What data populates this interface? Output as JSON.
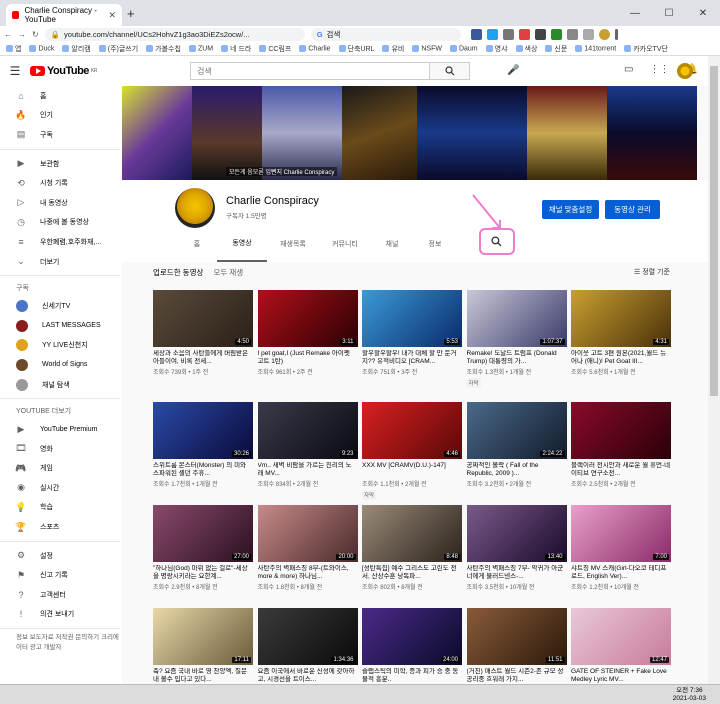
{
  "browser": {
    "tab_title": "Charlie Conspiracy - YouTube",
    "new_tab": "+",
    "url": "youtube.com/channel/UCs2HohvZ1g3ao3DiEZs2ocw/...",
    "google_search": "검색",
    "bookmarks": [
      "앱",
      "Duck",
      "알리캠",
      "(주)글쓰기",
      "가볼수칩",
      "ZUM",
      "네 드라",
      "CC림프",
      "Charlie",
      "단축URL",
      "유비",
      "NSFW",
      "Daum",
      "영샤",
      "색상",
      "신문",
      "141torrent",
      "카카오TV단"
    ]
  },
  "yt": {
    "logo_text": "YouTube",
    "logo_region": "KR",
    "search_placeholder": "검색"
  },
  "sidebar": {
    "main": [
      {
        "label": "홈",
        "icon": "home-icon"
      },
      {
        "label": "인기",
        "icon": "fire-icon"
      },
      {
        "label": "구독",
        "icon": "subscriptions-icon"
      }
    ],
    "library": [
      {
        "label": "보관함",
        "icon": "library-icon"
      },
      {
        "label": "시청 기록",
        "icon": "history-icon"
      },
      {
        "label": "내 동영상",
        "icon": "my-videos-icon"
      },
      {
        "label": "나중에 볼 동영상",
        "icon": "clock-icon"
      },
      {
        "label": "우한폐렴,호주화재,...",
        "icon": "playlist-icon"
      },
      {
        "label": "더보기",
        "icon": "chevron-down-icon"
      }
    ],
    "subs_head": "구독",
    "subs": [
      {
        "label": "신세기TV",
        "color": "#4a76c9"
      },
      {
        "label": "LAST MESSAGES",
        "color": "#8a1c1c"
      },
      {
        "label": "YY LIVE신천지",
        "color": "#e0a020"
      },
      {
        "label": "World of Signs",
        "color": "#6a4a2a"
      },
      {
        "label": "채널 탐색",
        "color": "#999999"
      }
    ],
    "more_head": "YOUTUBE 더보기",
    "more": [
      {
        "label": "YouTube Premium",
        "icon": "youtube-icon"
      },
      {
        "label": "영화",
        "icon": "film-icon"
      },
      {
        "label": "게임",
        "icon": "gamepad-icon"
      },
      {
        "label": "실시간",
        "icon": "live-icon"
      },
      {
        "label": "학습",
        "icon": "bulb-icon"
      },
      {
        "label": "스포츠",
        "icon": "trophy-icon"
      }
    ],
    "settings": [
      {
        "label": "설정",
        "icon": "gear-icon"
      },
      {
        "label": "신고 기록",
        "icon": "flag-icon"
      },
      {
        "label": "고객센터",
        "icon": "help-icon"
      },
      {
        "label": "의견 보내기",
        "icon": "feedback-icon"
      }
    ],
    "footer": "정보 보도자료 저작권 문의하기 크리에이터 광고 개발자"
  },
  "banner": {
    "caption": "모든게 음모론 입뻔지 Charlie Conspiracy"
  },
  "channel": {
    "name": "Charlie Conspiracy",
    "subscribers": "구독자 1.5만명",
    "customize_label": "채널 맞춤설정",
    "manage_label": "동영상 관리",
    "tabs": [
      "홈",
      "동영상",
      "재생목록",
      "커뮤니티",
      "채널",
      "정보"
    ],
    "active_tab": "동영상"
  },
  "videos_section": {
    "title": "업로드한 동영상",
    "play_all": "모두 재생",
    "sort_label": "정렬 기준"
  },
  "videos": [
    {
      "title": "세상과 소음의 사탄들에게 버림받은 아들이여, 비록 전세...",
      "meta": "조회수 739회 • 1주 전",
      "duration": "4:50",
      "c1": "#5a4a3a",
      "c2": "#2a2018"
    },
    {
      "title": "I pet goat,I (Just Remake 아이펫 고트 1탄)",
      "meta": "조회수 961회 • 2주 전",
      "duration": "3:11",
      "c1": "#b0101a",
      "c2": "#2a0004"
    },
    {
      "title": "할우할우할우! 내가 대체 할 만 둔거지?? 유적비디오 [CRAM...",
      "meta": "조회수 751회 • 3주 전",
      "duration": "5:53",
      "c1": "#3a9ad8",
      "c2": "#0a2a6a"
    },
    {
      "title": "Remake! 도날드 트럼프 (Donald Trump) 대통령의 가...",
      "meta": "조회수 1.3천회 • 1개월 전",
      "duration": "1:07:37",
      "c1": "#c8c8d8",
      "c2": "#3a3a6a",
      "badge": "자막"
    },
    {
      "title": "아이웃 고트 3편 원본(2021,월드 뉴어나 (애니)! Pet Goat III...",
      "meta": "조회수 5.6천회 • 1개월 전",
      "duration": "4:31",
      "c1": "#c8a030",
      "c2": "#4a3008"
    },
    {
      "title": "스위트룸 몬스터(Monster) 의 미와 스파워된 셸던 주휴...",
      "meta": "조회수 1.7천회 • 1개월 전",
      "duration": "30:26",
      "c1": "#2a4aa8",
      "c2": "#0a0a3a"
    },
    {
      "title": "Vm.. 새벽 비람을 가르는 진리의 노래 MV...",
      "meta": "조회수 834회 • 2개월 전",
      "duration": "9:23",
      "c1": "#3a3a4a",
      "c2": "#0a0a12"
    },
    {
      "title": "XXX MV [CRAMV(D.U.)-147]",
      "meta": "조회수 1.1천회 • 2개월 전",
      "duration": "4:46",
      "c1": "#d82020",
      "c2": "#5a0808",
      "badge": "자막"
    },
    {
      "title": "공짜적인 몰락 ( Fall of the Republic, 2009 )...",
      "meta": "조회수 3.2천회 • 2개월 전",
      "duration": "2:24:22",
      "c1": "#4a6a8a",
      "c2": "#121a2a"
    },
    {
      "title": "블랙이러 전시안과 새로운 월 휴먼-네이티브 연구소전...",
      "meta": "조회수 2.5천회 • 2개월 전",
      "duration": "",
      "c1": "#8a0a2a",
      "c2": "#2a0008"
    },
    {
      "title": "\"하나님(God) 마위 없는 걸로\"-세상을 명랑시키라는 요한계...",
      "meta": "조회수 2.9천회 • 8개월 전",
      "duration": "27:00",
      "c1": "#8a4a6a",
      "c2": "#2a1020"
    },
    {
      "title": "사탄주의 벽패스칭 8부-(트와이스, more & more) 하나님...",
      "meta": "조회수 1.8천회 • 8개월 전",
      "duration": "20:00",
      "c1": "#c88a8a",
      "c2": "#4a2a2a"
    },
    {
      "title": "[성탄특집] 예수 그리스도 고린도 전서, 산상수훈 낭독파...",
      "meta": "조회수 802회 • 8개월 전",
      "duration": "8:48",
      "c1": "#9a8a7a",
      "c2": "#2a221a"
    },
    {
      "title": "사탄주의 벽패스칭 7부- 악귀가 아군 너에게 불러드넨스-...",
      "meta": "조회수 3.5천회 • 10개월 전",
      "duration": "13:40",
      "c1": "#7a5a8a",
      "c2": "#1a0a2a"
    },
    {
      "title": "샤트칭 MV 스캐(Girl-다오코 테디프로드, English Ver)...",
      "meta": "조회수 1.2천회 • 10개월 전",
      "duration": "7:00",
      "c1": "#e8a0c8",
      "c2": "#8a2a6a"
    },
    {
      "title": "축? 요즘 국내 바로 영 찬양엑, 질문 내 볼수 입다고 있다...",
      "meta": "",
      "duration": "17:11",
      "c1": "#e8d8a8",
      "c2": "#6a5a3a"
    },
    {
      "title": "요즘 이국에서 바로운 신성에 갖아하고, 시경선을 트이스...",
      "meta": "",
      "duration": "1:34:36",
      "c1": "#3a3a3a",
      "c2": "#0a0a0a"
    },
    {
      "title": "슬랩스틱의 미학, 증과 피가 승 중 동물적 흥분..",
      "meta": "",
      "duration": "24:00",
      "c1": "#4a2a8a",
      "c2": "#0a0a2a"
    },
    {
      "title": "(거친) 매스트 월드 시즌2-존 규모 성 공리중 흐워래 가지...",
      "meta": "",
      "duration": "11:51",
      "c1": "#8a5a3a",
      "c2": "#2a1a0a"
    },
    {
      "title": "GATE OF STEINER + Fake Love Medley Lyric MV...",
      "meta": "",
      "duration": "12:47",
      "c1": "#e8c8d8",
      "c2": "#c87a9a"
    }
  ],
  "taskbar": {
    "time": "오전 7:36",
    "date": "2021-03-03"
  },
  "colors": {
    "yt_red": "#ff0000",
    "accent_blue": "#065fd4",
    "highlight_pink": "#f07ccf"
  }
}
